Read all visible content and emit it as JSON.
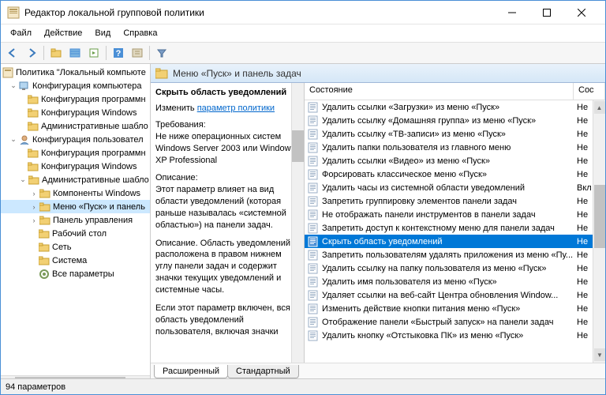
{
  "titlebar": {
    "title": "Редактор локальной групповой политики"
  },
  "menu": {
    "file": "Файл",
    "action": "Действие",
    "view": "Вид",
    "help": "Справка"
  },
  "tree": {
    "root": "Политика \"Локальный компьюте",
    "comp_cfg": "Конфигурация компьютера",
    "comp_soft": "Конфигурация программн",
    "comp_win": "Конфигурация Windows",
    "comp_admin": "Административные шабло",
    "user_cfg": "Конфигурация пользовател",
    "user_soft": "Конфигурация программн",
    "user_win": "Конфигурация Windows",
    "user_admin": "Административные шабло",
    "win_comp": "Компоненты Windows",
    "start_taskbar": "Меню «Пуск» и панель",
    "ctrl_panel": "Панель управления",
    "desktop": "Рабочий стол",
    "network": "Сеть",
    "system": "Система",
    "all_params": "Все параметры"
  },
  "header": {
    "title": "Меню «Пуск» и панель задач"
  },
  "desc": {
    "title": "Скрыть область уведомлений",
    "edit_prefix": "Изменить ",
    "edit_link": "параметр политики",
    "req_h": "Требования:",
    "req_t": "Не ниже операционных систем Windows Server 2003 или Windows XP Professional",
    "desc_h": "Описание:",
    "desc_p1": "Этот параметр влияет на вид области уведомлений (которая раньше называлась «системной областью») на панели задач.",
    "desc_p2": "Описание. Область уведомлений расположена в правом нижнем углу панели задач и содержит значки текущих уведомлений и системные часы.",
    "desc_p3": "Если этот параметр включен, вся область уведомлений пользователя, включая значки"
  },
  "grid": {
    "col_state": "Состояние",
    "col_cfg": "Сос",
    "rows": [
      {
        "n": "Удалить ссылки «Загрузки» из меню «Пуск»",
        "s": "Не"
      },
      {
        "n": "Удалить ссылку «Домашняя группа» из меню «Пуск»",
        "s": "Не"
      },
      {
        "n": "Удалить ссылку «ТВ-записи» из меню «Пуск»",
        "s": "Не"
      },
      {
        "n": "Удалить папки пользователя из главного меню",
        "s": "Не"
      },
      {
        "n": "Удалить ссылки «Видео» из меню «Пуск»",
        "s": "Не"
      },
      {
        "n": "Форсировать классическое меню «Пуск»",
        "s": "Не"
      },
      {
        "n": "Удалить часы из системной области уведомлений",
        "s": "Вкл"
      },
      {
        "n": "Запретить группировку элементов панели задач",
        "s": "Не"
      },
      {
        "n": "Не отображать панели инструментов в панели задач",
        "s": "Не"
      },
      {
        "n": "Запретить доступ к контекстному меню для панели задач",
        "s": "Не"
      },
      {
        "n": "Скрыть область уведомлений",
        "s": "Не",
        "sel": true
      },
      {
        "n": "Запретить пользователям удалять приложения из меню «Пу...",
        "s": "Не"
      },
      {
        "n": "Удалить ссылку на папку пользователя из меню «Пуск»",
        "s": "Не"
      },
      {
        "n": "Удалить имя пользователя из меню «Пуск»",
        "s": "Не"
      },
      {
        "n": "Удаляет ссылки на веб-сайт Центра обновления Window...",
        "s": "Не"
      },
      {
        "n": "Изменить действие кнопки питания меню «Пуск»",
        "s": "Не"
      },
      {
        "n": "Отображение панели «Быстрый запуск» на панели задач",
        "s": "Не"
      },
      {
        "n": "Удалить кнопку «Отстыковка ПК» из меню «Пуск»",
        "s": "Не"
      }
    ]
  },
  "tabs": {
    "ext": "Расширенный",
    "std": "Стандартный"
  },
  "status": {
    "count": "94 параметров"
  }
}
